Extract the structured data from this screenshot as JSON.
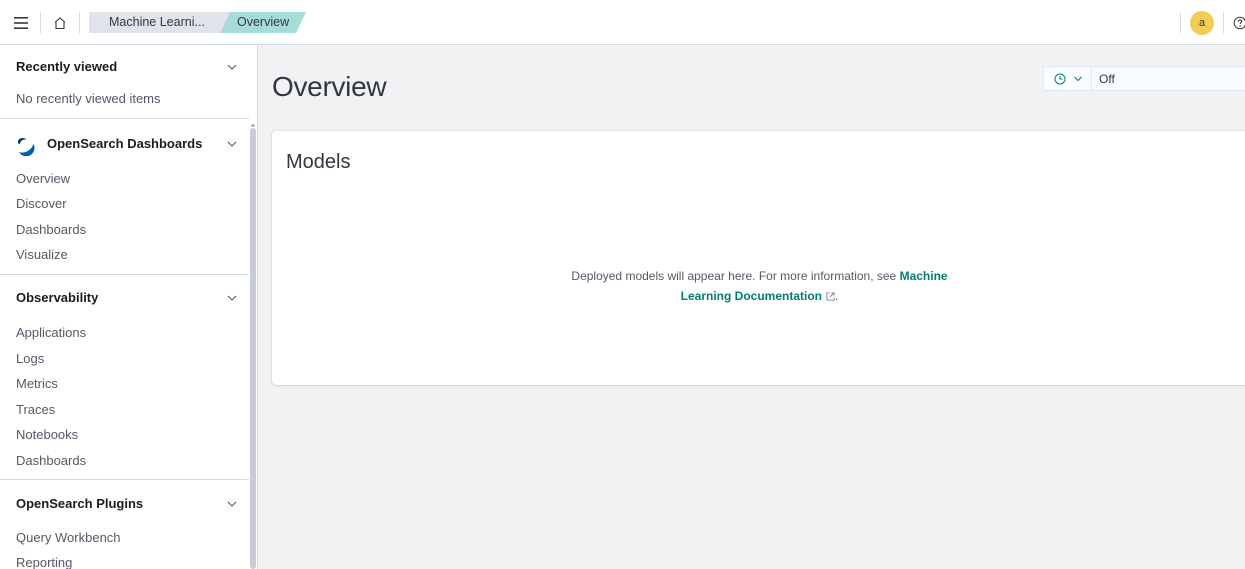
{
  "header": {
    "breadcrumbs": [
      {
        "label": "Machine Learni..."
      },
      {
        "label": "Overview"
      }
    ],
    "avatar_initial": "a",
    "icons": {
      "menu": "hamburger-menu-icon",
      "home": "home-icon",
      "help": "help-icon"
    }
  },
  "sidebar": {
    "recently_viewed": {
      "title": "Recently viewed",
      "empty_text": "No recently viewed items"
    },
    "groups": [
      {
        "title": "OpenSearch Dashboards",
        "items": [
          "Overview",
          "Discover",
          "Dashboards",
          "Visualize"
        ]
      },
      {
        "title": "Observability",
        "items": [
          "Applications",
          "Logs",
          "Metrics",
          "Traces",
          "Notebooks",
          "Dashboards"
        ]
      },
      {
        "title": "OpenSearch Plugins",
        "items": [
          "Query Workbench",
          "Reporting"
        ]
      }
    ]
  },
  "main": {
    "title": "Overview",
    "refresh": {
      "value": "Off"
    },
    "panel": {
      "title": "Models",
      "empty_prefix": "Deployed models will appear here. For more information, see",
      "link_text": "Machine Learning Documentation",
      "suffix": "."
    }
  },
  "colors": {
    "accent": "#017d73",
    "breadcrumb_active": "#a5dcd8",
    "avatar": "#f1cd56",
    "logo_dark": "#005eb8",
    "logo_light": "#003b5c"
  }
}
